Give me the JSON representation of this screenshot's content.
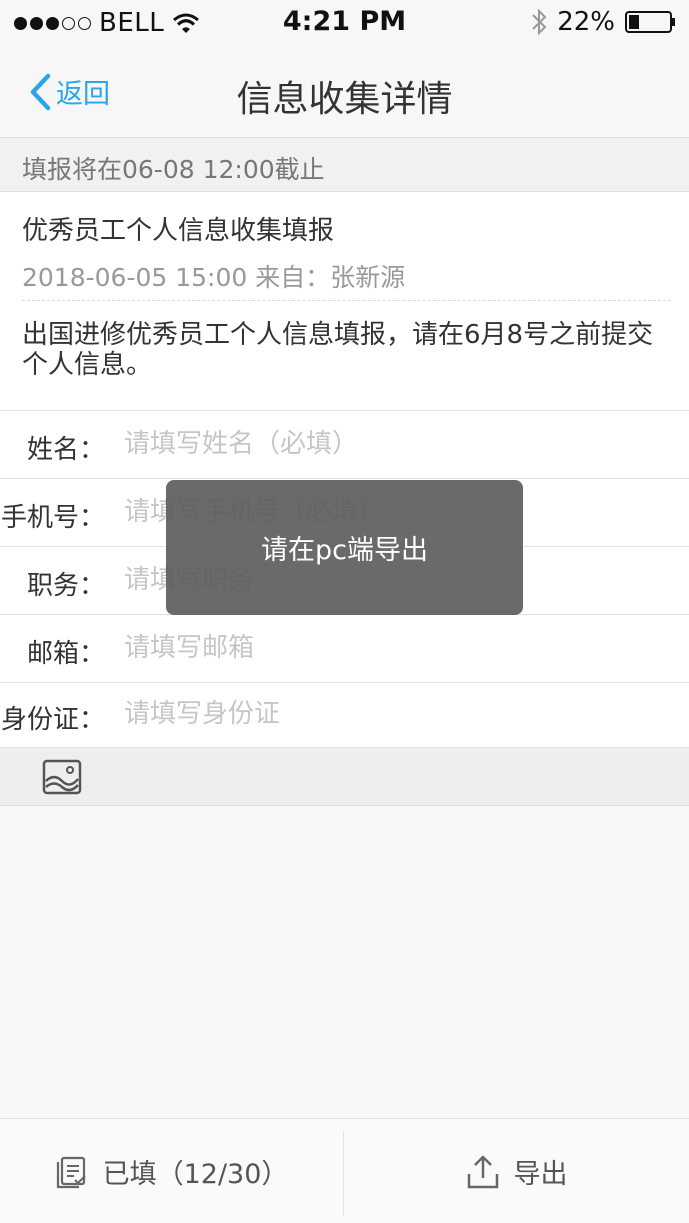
{
  "status_bar": {
    "carrier": "BELL",
    "time": "4:21 PM",
    "battery": "22%",
    "icons": [
      "signal-dots-icon",
      "wifi-icon",
      "bluetooth-icon",
      "battery-icon"
    ]
  },
  "nav": {
    "back_label": "返回",
    "title": "信息收集详情"
  },
  "deadline": "填报将在06-08  12:00截止",
  "info": {
    "title": "优秀员工个人信息收集填报",
    "meta": "2018-06-05  15:00  来自：张新源",
    "description": "出国进修优秀员工个人信息填报，请在6月8号之前提交个人信息。"
  },
  "form": {
    "fields": [
      {
        "label": "姓名：",
        "value": "",
        "placeholder": "请填写姓名（必填）"
      },
      {
        "label": "手机号：",
        "value": "",
        "placeholder": "请填写手机号（必填）"
      },
      {
        "label": "职务：",
        "value": "",
        "placeholder": "请填写职务"
      },
      {
        "label": "邮箱：",
        "value": "",
        "placeholder": "请填写邮箱"
      },
      {
        "label": "身份证：",
        "value": "",
        "placeholder": "请填写身份证"
      }
    ]
  },
  "attachment": {
    "icon": "image-icon"
  },
  "toast": {
    "text": "请在pc端导出"
  },
  "bottom_bar": {
    "filled_label": "已填（12/30）",
    "export_label": "导出",
    "icons": [
      "filled-list-icon",
      "export-icon"
    ]
  },
  "colors": {
    "accent": "#2aa4ea",
    "toast_bg": "#5a5a5a",
    "placeholder": "#c6c6c6"
  }
}
